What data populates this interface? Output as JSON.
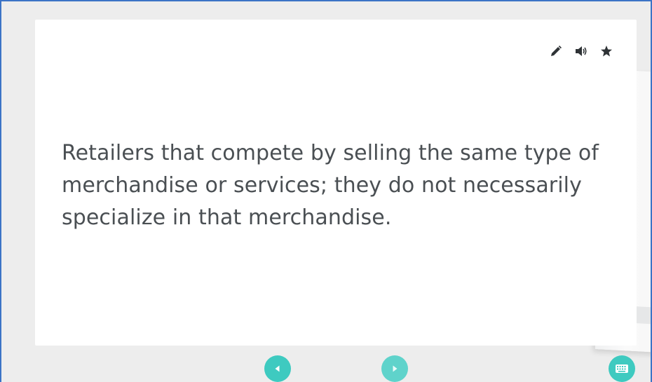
{
  "card": {
    "text": "Retailers that compete by selling the same type of merchandise or services; they do not necessarily specialize in that merchandise.",
    "tools": [
      {
        "icon": "pencil-icon"
      },
      {
        "icon": "speaker-icon"
      },
      {
        "icon": "star-icon"
      }
    ]
  },
  "controls": {
    "prev_icon": "triangle-left-icon",
    "next_icon": "triangle-right-icon",
    "keyboard_icon": "keyboard-icon"
  },
  "colors": {
    "accent": "#3ecac0",
    "text": "#4a4f53",
    "card_bg": "#ffffff",
    "page_bg": "#ededed",
    "frame_border": "#3b73c6"
  }
}
